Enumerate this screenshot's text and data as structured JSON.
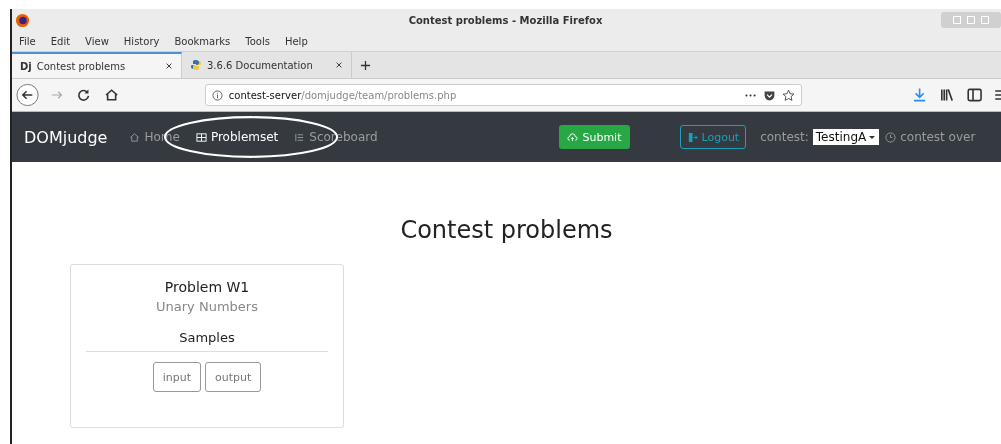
{
  "window": {
    "title": "Contest problems - Mozilla Firefox"
  },
  "menu": [
    "File",
    "Edit",
    "View",
    "History",
    "Bookmarks",
    "Tools",
    "Help"
  ],
  "tabs": [
    {
      "label": "Contest problems",
      "kind": "text-favicon",
      "favicon": "Dj",
      "selected": true
    },
    {
      "label": "3.6.6 Documentation",
      "kind": "python",
      "selected": false
    }
  ],
  "address": {
    "host": "contest-server",
    "path": "/domjudge/team/problems.php"
  },
  "navbar": {
    "brand": "DOMjudge",
    "links": [
      {
        "label": "Home",
        "kind": "home"
      },
      {
        "label": "Problemset",
        "kind": "problems"
      },
      {
        "label": "Scoreboard",
        "kind": "scoreboard"
      }
    ],
    "submit": "Submit",
    "logout": "Logout",
    "contest_label": "contest:",
    "contest": "TestingA",
    "status": "contest over"
  },
  "heading": "Contest problems",
  "problems": [
    {
      "name": "Problem W1",
      "title": "Unary Numbers",
      "samples_label": "Samples",
      "buttons": [
        "input",
        "output"
      ]
    }
  ]
}
